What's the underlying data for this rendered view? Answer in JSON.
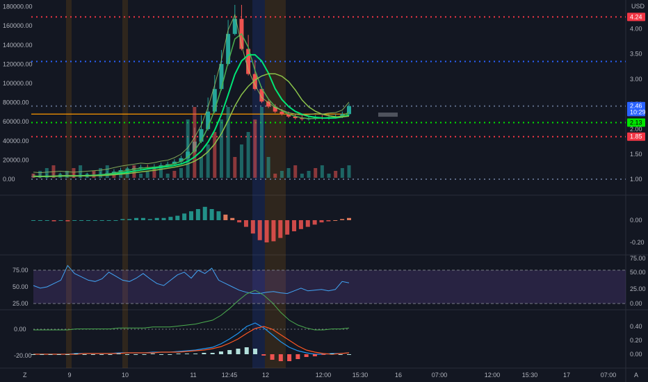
{
  "chart_data": [
    {
      "type": "candlestick",
      "panel": "price",
      "currency": "USD",
      "left_axis_ticks": [
        "0.00",
        "20000.00",
        "40000.00",
        "60000.00",
        "80000.00",
        "100000.00",
        "120000.00",
        "140000.00",
        "160000.00",
        "180000.00"
      ],
      "right_axis_ticks": [
        "1.00",
        "1.50",
        "2.00",
        "2.50",
        "3.00",
        "3.50",
        "4.00"
      ],
      "ylim_right": [
        1.0,
        4.3
      ],
      "price_tags": [
        {
          "label": "4.24",
          "value": 4.24,
          "color": "#f23645"
        },
        {
          "label": "2.46",
          "value": 2.46,
          "color": "#2962ff"
        },
        {
          "label": "10:29",
          "value": 2.34,
          "color": "#2962ff"
        },
        {
          "label": "2.13",
          "value": 2.13,
          "color": "#00e600"
        },
        {
          "label": "1.85",
          "value": 1.85,
          "color": "#f23645"
        }
      ],
      "horizontal_levels": [
        {
          "value": 4.24,
          "color": "#f23645",
          "style": "dotted"
        },
        {
          "value": 3.35,
          "color": "#2962ff",
          "style": "dotted"
        },
        {
          "value": 2.46,
          "color": "#5d6b88",
          "style": "dotted"
        },
        {
          "value": 2.3,
          "color": "#ff9800",
          "style": "solid"
        },
        {
          "value": 2.13,
          "color": "#00e600",
          "style": "dotted"
        },
        {
          "value": 1.85,
          "color": "#f23645",
          "style": "dotted"
        },
        {
          "value": 1.0,
          "color": "#5d6b88",
          "style": "dotted"
        }
      ],
      "close_approx": [
        1.06,
        1.05,
        1.06,
        1.07,
        1.08,
        1.07,
        1.06,
        1.07,
        1.08,
        1.09,
        1.1,
        1.12,
        1.15,
        1.18,
        1.2,
        1.22,
        1.24,
        1.23,
        1.25,
        1.28,
        1.3,
        1.35,
        1.42,
        1.55,
        1.75,
        2.0,
        2.35,
        2.8,
        3.3,
        3.9,
        4.2,
        3.6,
        3.1,
        2.8,
        2.55,
        2.45,
        2.35,
        2.3,
        2.25,
        2.22,
        2.2,
        2.21,
        2.23,
        2.22,
        2.24,
        2.25,
        2.3,
        2.46
      ]
    },
    {
      "type": "histogram",
      "panel": "oscillator",
      "right_axis_ticks": [
        "0.00",
        "-0.20"
      ],
      "values": [
        0.0,
        0.0,
        0.0,
        -0.01,
        0.0,
        -0.01,
        0.0,
        0.0,
        0.0,
        0.0,
        0.0,
        0.0,
        0.0,
        0.01,
        0.01,
        0.02,
        0.02,
        0.01,
        0.02,
        0.02,
        0.03,
        0.04,
        0.06,
        0.08,
        0.1,
        0.12,
        0.1,
        0.08,
        0.05,
        0.02,
        -0.02,
        -0.06,
        -0.12,
        -0.18,
        -0.2,
        -0.19,
        -0.16,
        -0.13,
        -0.1,
        -0.08,
        -0.06,
        -0.04,
        -0.02,
        -0.01,
        0.0,
        0.01,
        0.02
      ]
    },
    {
      "type": "line",
      "panel": "rsi",
      "left_axis_ticks": [
        "25.00",
        "50.00",
        "75.00"
      ],
      "right_axis_ticks": [
        "75.00",
        "50.00",
        "25.00",
        "0.00"
      ],
      "bands": [
        25,
        75
      ],
      "values": [
        52,
        48,
        50,
        55,
        60,
        82,
        70,
        65,
        60,
        58,
        62,
        72,
        66,
        60,
        58,
        63,
        70,
        62,
        55,
        52,
        60,
        68,
        72,
        63,
        75,
        70,
        78,
        60,
        55,
        50,
        45,
        42,
        40,
        40,
        42,
        43,
        41,
        40,
        44,
        48,
        44,
        45,
        46,
        44,
        46,
        58,
        56
      ]
    },
    {
      "type": "line",
      "panel": "macd",
      "left_axis_ticks": [
        "0.00",
        "-20.00"
      ],
      "right_axis_ticks": [
        "0.40",
        "0.20",
        "0.00"
      ],
      "series": [
        {
          "color": "#2196f3",
          "values": [
            0,
            0,
            0,
            0,
            0,
            0.01,
            0.01,
            0.01,
            0.01,
            0.01,
            0.02,
            0.02,
            0.02,
            0.02,
            0.03,
            0.03,
            0.03,
            0.04,
            0.05,
            0.06,
            0.08,
            0.1,
            0.15,
            0.22,
            0.3,
            0.4,
            0.45,
            0.38,
            0.28,
            0.18,
            0.1,
            0.05,
            0.02,
            0.0,
            0.0,
            0.01,
            0.01,
            0.02
          ]
        },
        {
          "color": "#ff5722",
          "values": [
            0,
            0,
            0,
            0,
            0,
            0,
            0.01,
            0.01,
            0.01,
            0.01,
            0.01,
            0.02,
            0.02,
            0.02,
            0.02,
            0.03,
            0.03,
            0.03,
            0.04,
            0.05,
            0.06,
            0.08,
            0.11,
            0.16,
            0.22,
            0.3,
            0.37,
            0.4,
            0.36,
            0.28,
            0.2,
            0.12,
            0.06,
            0.03,
            0.01,
            0.0,
            0.01,
            0.02
          ]
        }
      ]
    }
  ],
  "x_axis_labels": [
    "9",
    "10",
    "11",
    "12:45",
    "12",
    "12:00",
    "15:30",
    "16",
    "07:00",
    "12:00",
    "15:30",
    "17",
    "07:00"
  ]
}
